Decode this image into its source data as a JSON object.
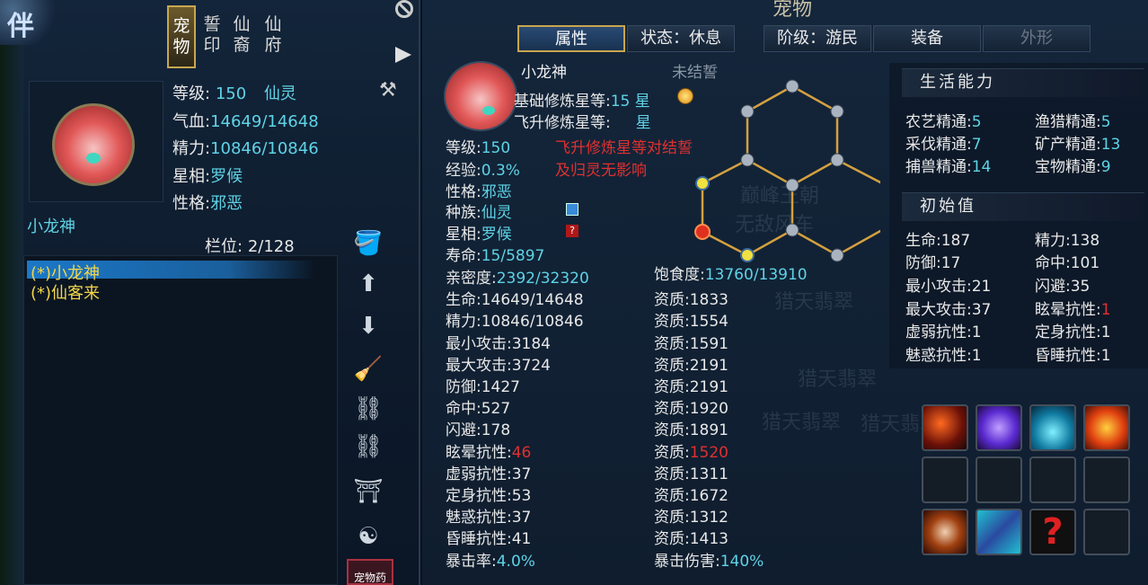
{
  "logo": {
    "glyph": "伴"
  },
  "left_tabs": [
    {
      "label": "宠\n物",
      "active": true
    },
    {
      "label": "誓\n印",
      "active": false
    },
    {
      "label": "仙\n裔",
      "active": false
    },
    {
      "label": "仙\n府",
      "active": false
    }
  ],
  "left_stats": {
    "level_label": "等级:",
    "level_value": "150",
    "level_race": "仙灵",
    "hp_label": "气血:",
    "hp_value": "14649/14648",
    "mp_label": "精力:",
    "mp_value": "10846/10846",
    "star_label": "星相:",
    "star_value": "罗候",
    "nature_label": "性格:",
    "nature_value": "邪恶"
  },
  "pet_name_left": "小龙神",
  "slots": {
    "label": "栏位:",
    "value": "2/128"
  },
  "pet_list": [
    "(*)小龙神",
    "(*)仙客来"
  ],
  "side_button_last": "宠物药",
  "right": {
    "title": "宠物",
    "tabs": [
      "属性",
      "状态：休息",
      "阶级：游民",
      "装备",
      "外形"
    ],
    "pet_name": "小龙神",
    "bond_status": "未结誓",
    "base_star_label": "基础修炼星等:",
    "base_star_value": "15 星",
    "ascend_star_label": "飞升修炼星等:",
    "ascend_star_value": "星",
    "notice_line1": "飞升修炼星等对结誓",
    "notice_line2": "及归灵无影响",
    "level_label": "等级:",
    "level_value": "150",
    "exp_label": "经验:",
    "exp_value": "0.3%",
    "nature_label": "性格:",
    "nature_value": "邪恶",
    "race_label": "种族:",
    "race_value": "仙灵",
    "star_label": "星相:",
    "star_value": "罗候",
    "life_label": "寿命:",
    "life_value": "15/5897",
    "intimacy_label": "亲密度:",
    "intimacy_value": "2392/32320",
    "satiety_label": "饱食度:",
    "satiety_value": "13760/13910",
    "attrs": [
      {
        "label": "生命:",
        "value": "14649/14648",
        "q_label": "资质:",
        "q": "1833"
      },
      {
        "label": "精力:",
        "value": "10846/10846",
        "q_label": "资质:",
        "q": "1554"
      },
      {
        "label": "最小攻击:",
        "value": "3184",
        "q_label": "资质:",
        "q": "1591"
      },
      {
        "label": "最大攻击:",
        "value": "3724",
        "q_label": "资质:",
        "q": "2191"
      },
      {
        "label": "防御:",
        "value": "1427",
        "q_label": "资质:",
        "q": "2191"
      },
      {
        "label": "命中:",
        "value": "527",
        "q_label": "资质:",
        "q": "1920"
      },
      {
        "label": "闪避:",
        "value": "178",
        "q_label": "资质:",
        "q": "1891"
      },
      {
        "label": "眩晕抗性:",
        "value": "46",
        "q_label": "资质:",
        "q": "1520"
      },
      {
        "label": "虚弱抗性:",
        "value": "37",
        "q_label": "资质:",
        "q": "1311"
      },
      {
        "label": "定身抗性:",
        "value": "53",
        "q_label": "资质:",
        "q": "1672"
      },
      {
        "label": "魅惑抗性:",
        "value": "37",
        "q_label": "资质:",
        "q": "1312"
      },
      {
        "label": "昏睡抗性:",
        "value": "41",
        "q_label": "资质:",
        "q": "1413"
      }
    ],
    "crit_label": "暴击率:",
    "crit_value": "4.0%",
    "crit_dmg_label": "暴击伤害:",
    "crit_dmg_value": "140%",
    "watermarks": [
      "猎天翡翠",
      "猎天翡翠",
      "猎天翡翠",
      "猎天翡翠",
      "无敌风车",
      "巅峰王朝"
    ]
  },
  "life_skills": {
    "title": "生活能力",
    "items": [
      {
        "label": "农艺精通:",
        "value": "5"
      },
      {
        "label": "渔猎精通:",
        "value": "5"
      },
      {
        "label": "采伐精通:",
        "value": "7"
      },
      {
        "label": "矿产精通:",
        "value": "13"
      },
      {
        "label": "捕兽精通:",
        "value": "14"
      },
      {
        "label": "宝物精通:",
        "value": "9"
      }
    ]
  },
  "initial": {
    "title": "初始值",
    "items": [
      {
        "label": "生命:",
        "value": "187"
      },
      {
        "label": "精力:",
        "value": "138"
      },
      {
        "label": "防御:",
        "value": "17"
      },
      {
        "label": "命中:",
        "value": "101"
      },
      {
        "label": "最小攻击:",
        "value": "21"
      },
      {
        "label": "闪避:",
        "value": "35"
      },
      {
        "label": "最大攻击:",
        "value": "37"
      },
      {
        "label": "眩晕抗性:",
        "value": "1"
      },
      {
        "label": "虚弱抗性:",
        "value": "1"
      },
      {
        "label": "定身抗性:",
        "value": "1"
      },
      {
        "label": "魅惑抗性:",
        "value": "1"
      },
      {
        "label": "昏睡抗性:",
        "value": "1"
      }
    ]
  },
  "colors": {
    "cyan": "#5fd3e6",
    "red": "#e03030",
    "gold": "#c8a650",
    "yellow": "#f2d64a"
  }
}
